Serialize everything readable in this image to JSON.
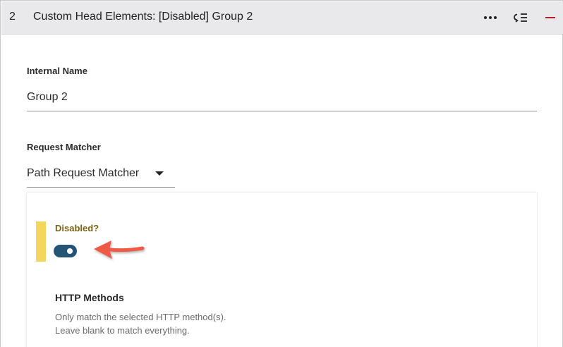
{
  "header": {
    "index": "2",
    "title": "Custom Head Elements: [Disabled] Group 2",
    "more_icon": "more-horizontal-icon",
    "reorder_icon": "reorder-list-icon",
    "collapse_icon": "minus-icon"
  },
  "internal_name": {
    "label": "Internal Name",
    "value": "Group 2"
  },
  "request_matcher": {
    "label": "Request Matcher",
    "selected": "Path Request Matcher"
  },
  "matcher_panel": {
    "disabled_label": "Disabled?",
    "disabled_on": true,
    "http_methods_label": "HTTP Methods",
    "help_line_1": "Only match the selected HTTP method(s).",
    "help_line_2": "Leave blank to match everything."
  },
  "colors": {
    "header_bg": "#e9e8ea",
    "toggle_on": "#255474",
    "accent_bar": "#f5d65c",
    "annotation_arrow": "#ef5a47",
    "collapse_icon": "#b3202a"
  }
}
